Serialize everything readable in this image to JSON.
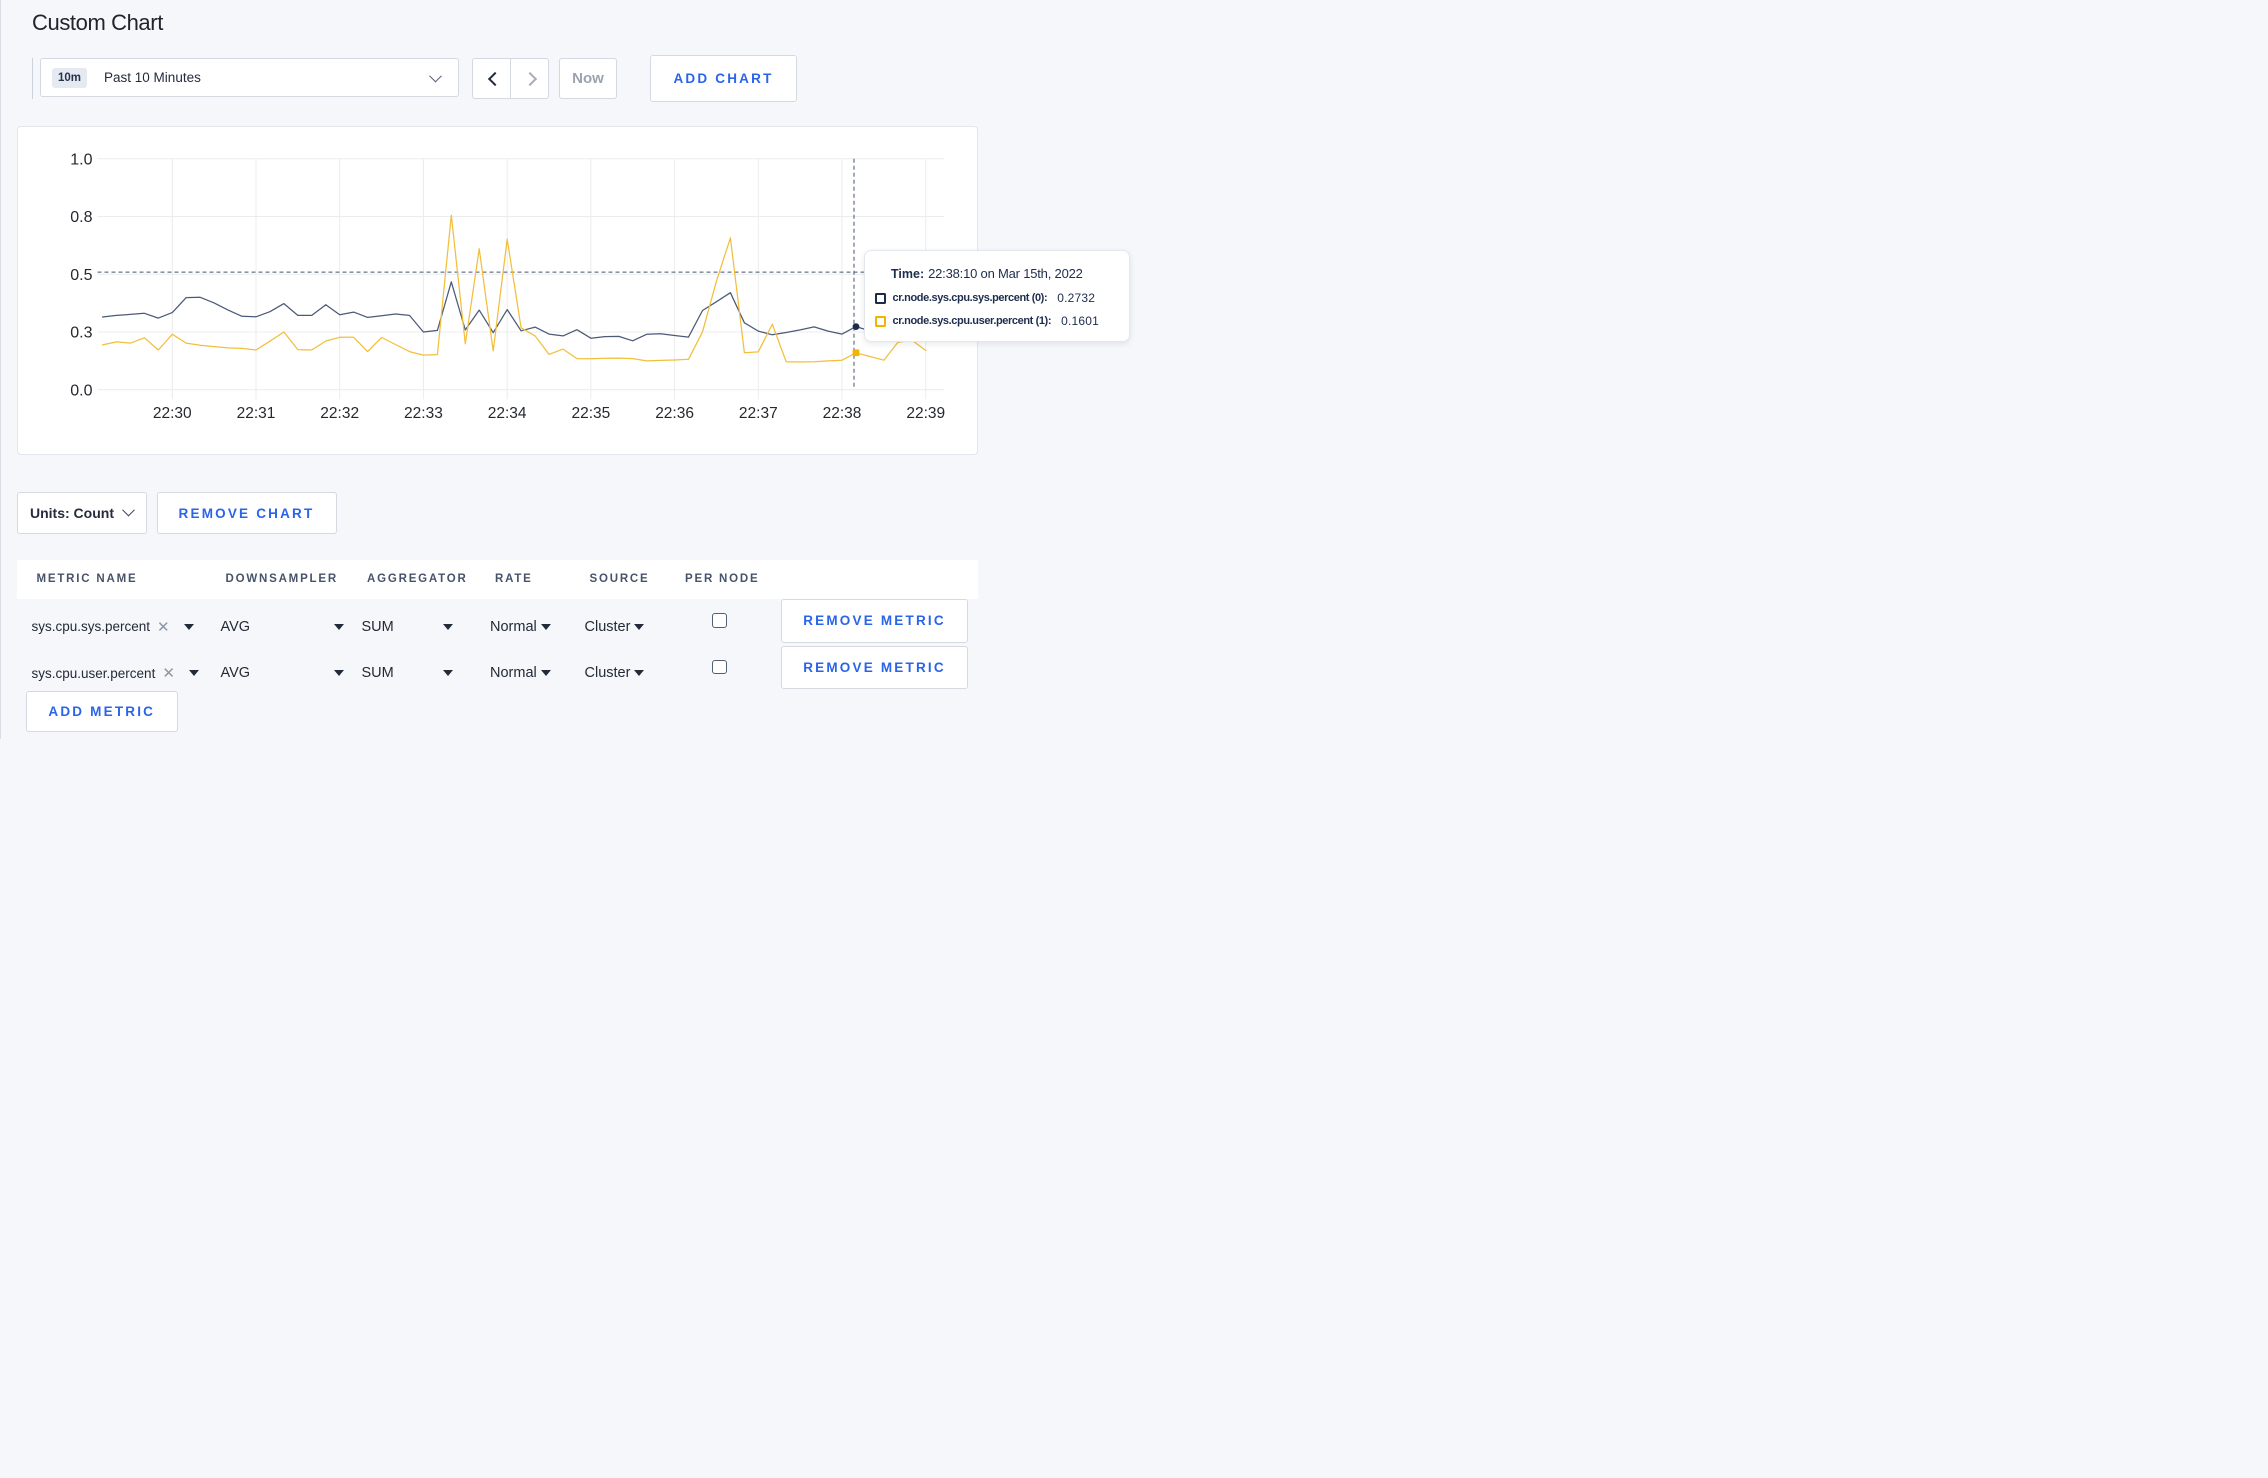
{
  "page": {
    "title": "Custom Chart"
  },
  "toolbar": {
    "range_badge": "10m",
    "range_label": "Past 10 Minutes",
    "now_label": "Now",
    "add_chart_label": "ADD CHART"
  },
  "chart_data": {
    "type": "line",
    "title": "",
    "xlabel": "",
    "ylabel": "",
    "ylim": [
      0,
      1
    ],
    "y_ticks": [
      {
        "value": 0,
        "label": "0.0"
      },
      {
        "value": 0.25,
        "label": "0.3"
      },
      {
        "value": 0.5,
        "label": "0.5"
      },
      {
        "value": 0.75,
        "label": "0.8"
      },
      {
        "value": 1.0,
        "label": "1.0"
      }
    ],
    "x_ticks": [
      "22:30",
      "22:31",
      "22:32",
      "22:33",
      "22:34",
      "22:35",
      "22:36",
      "22:37",
      "22:38",
      "22:39"
    ],
    "x_start": "22:29:10",
    "x_step_seconds": 10,
    "grid": true,
    "legend_position": "tooltip",
    "series": [
      {
        "name": "cr.node.sys.cpu.sys.percent",
        "color": "#4b5a77",
        "values": [
          0.315,
          0.322,
          0.326,
          0.331,
          0.31,
          0.334,
          0.399,
          0.4,
          0.376,
          0.345,
          0.318,
          0.316,
          0.338,
          0.373,
          0.322,
          0.322,
          0.368,
          0.325,
          0.336,
          0.313,
          0.32,
          0.328,
          0.322,
          0.25,
          0.257,
          0.467,
          0.259,
          0.345,
          0.247,
          0.347,
          0.255,
          0.271,
          0.241,
          0.233,
          0.26,
          0.223,
          0.23,
          0.231,
          0.212,
          0.24,
          0.242,
          0.235,
          0.228,
          0.343,
          0.381,
          0.42,
          0.29,
          0.254,
          0.238,
          0.248,
          0.259,
          0.272,
          0.254,
          0.241,
          0.2732,
          0.255,
          0.248,
          0.252,
          0.258,
          0.25
        ]
      },
      {
        "name": "cr.node.sys.cpu.user.percent",
        "color": "#f2bf3a",
        "values": [
          0.194,
          0.207,
          0.202,
          0.225,
          0.172,
          0.24,
          0.202,
          0.193,
          0.187,
          0.181,
          0.179,
          0.172,
          0.21,
          0.25,
          0.174,
          0.172,
          0.211,
          0.227,
          0.227,
          0.165,
          0.226,
          0.196,
          0.165,
          0.15,
          0.152,
          0.755,
          0.199,
          0.61,
          0.168,
          0.652,
          0.268,
          0.233,
          0.153,
          0.176,
          0.135,
          0.134,
          0.136,
          0.137,
          0.135,
          0.125,
          0.127,
          0.129,
          0.132,
          0.251,
          0.471,
          0.658,
          0.16,
          0.164,
          0.284,
          0.121,
          0.12,
          0.121,
          0.125,
          0.128,
          0.1601,
          0.144,
          0.128,
          0.205,
          0.215,
          0.17
        ]
      }
    ],
    "crosshair": {
      "x_index": 54,
      "y_value": 0.509
    }
  },
  "tooltip": {
    "time_label": "Time:",
    "time_value": "22:38:10 on Mar 15th, 2022",
    "entries": [
      {
        "label": "cr.node.sys.cpu.sys.percent (0):",
        "value": "0.2732",
        "color": "#1c2b4c"
      },
      {
        "label": "cr.node.sys.cpu.user.percent (1):",
        "value": "0.1601",
        "color": "#f1b500"
      }
    ]
  },
  "units": {
    "label": "Units: Count"
  },
  "chart_actions": {
    "remove_chart_label": "REMOVE CHART"
  },
  "metrics_table": {
    "headers": [
      "METRIC NAME",
      "DOWNSAMPLER",
      "AGGREGATOR",
      "RATE",
      "SOURCE",
      "PER NODE"
    ],
    "rows": [
      {
        "metric": "sys.cpu.sys.percent",
        "downsampler": "AVG",
        "aggregator": "SUM",
        "rate": "Normal",
        "source": "Cluster",
        "per_node": false,
        "remove_label": "REMOVE METRIC"
      },
      {
        "metric": "sys.cpu.user.percent",
        "downsampler": "AVG",
        "aggregator": "SUM",
        "rate": "Normal",
        "source": "Cluster",
        "per_node": false,
        "remove_label": "REMOVE METRIC"
      }
    ],
    "add_metric_label": "ADD METRIC"
  }
}
